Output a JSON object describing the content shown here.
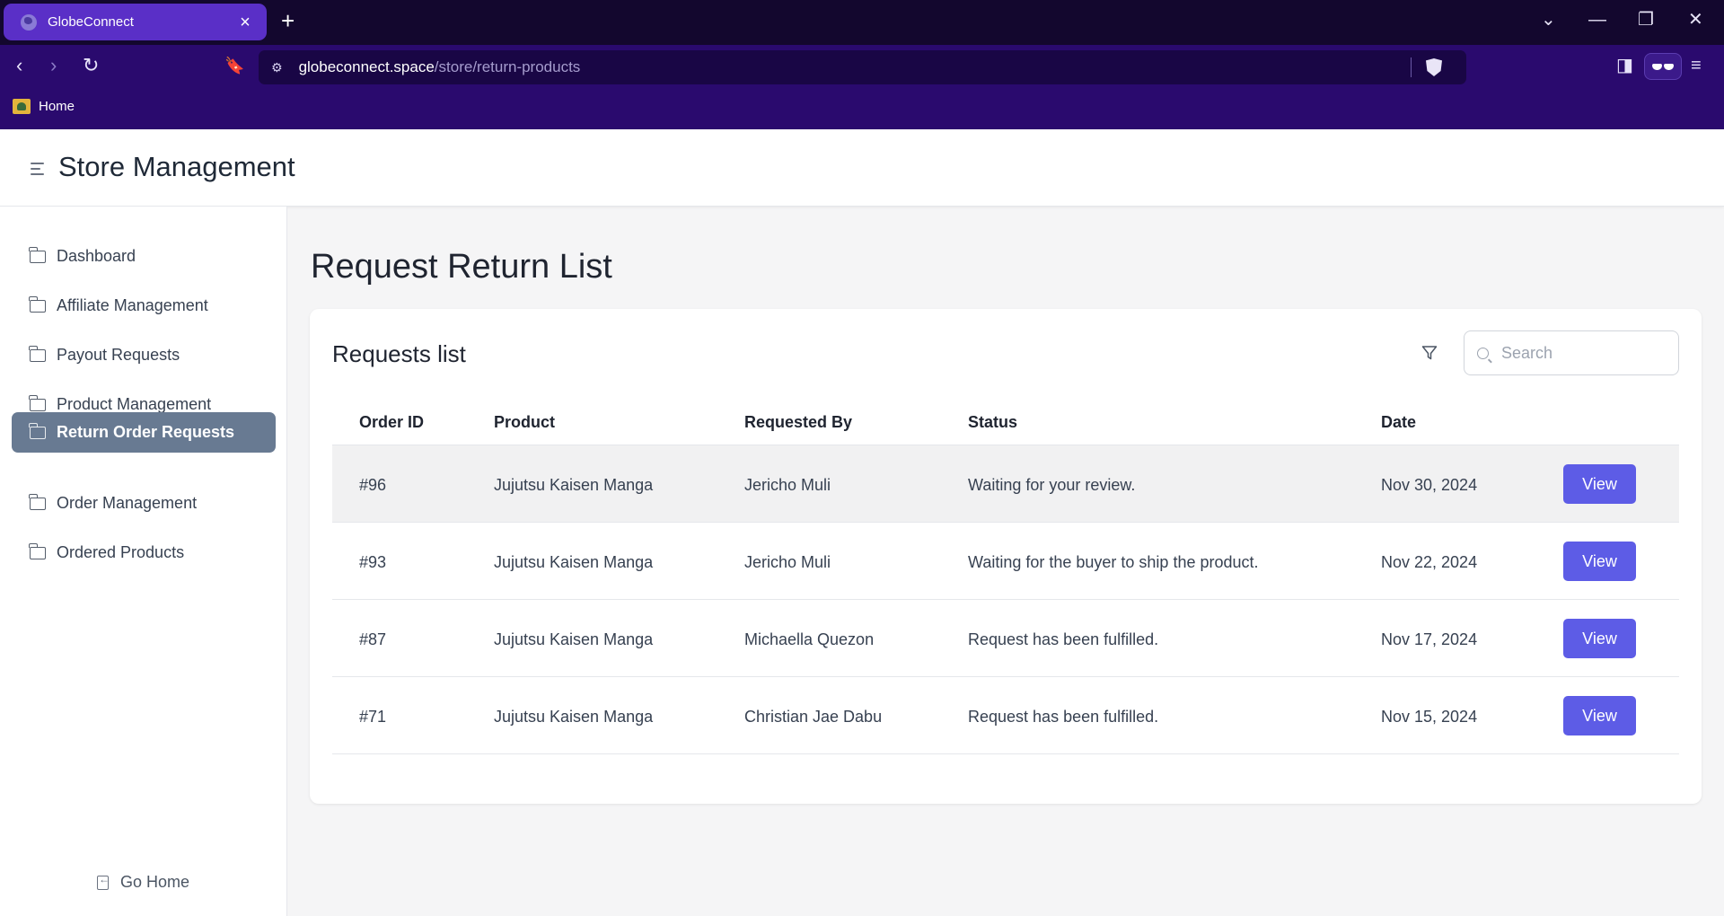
{
  "browser": {
    "tab_title": "GlobeConnect",
    "url_host": "globeconnect.space",
    "url_path": "/store/return-products",
    "bookmark_home": "Home"
  },
  "app": {
    "title": "Store Management"
  },
  "sidebar": {
    "items": [
      {
        "label": "Dashboard",
        "active": false
      },
      {
        "label": "Affiliate Management",
        "active": false
      },
      {
        "label": "Payout Requests",
        "active": false
      },
      {
        "label": "Product Management",
        "active": false
      },
      {
        "label": "Return Order Requests",
        "active": true
      },
      {
        "label": "Order Management",
        "active": false
      },
      {
        "label": "Ordered Products",
        "active": false
      }
    ],
    "go_home": "Go Home"
  },
  "main": {
    "page_title": "Request Return List",
    "card_title": "Requests list",
    "search_placeholder": "Search",
    "columns": [
      "Order ID",
      "Product",
      "Requested By",
      "Status",
      "Date"
    ],
    "rows": [
      {
        "order_id": "#96",
        "product": "Jujutsu Kaisen Manga",
        "requested_by": "Jericho Muli",
        "status": "Waiting for your review.",
        "date": "Nov 30, 2024",
        "action": "View"
      },
      {
        "order_id": "#93",
        "product": "Jujutsu Kaisen Manga",
        "requested_by": "Jericho Muli",
        "status": "Waiting for the buyer to ship the product.",
        "date": "Nov 22, 2024",
        "action": "View"
      },
      {
        "order_id": "#87",
        "product": "Jujutsu Kaisen Manga",
        "requested_by": "Michaella Quezon",
        "status": "Request has been fulfilled.",
        "date": "Nov 17, 2024",
        "action": "View"
      },
      {
        "order_id": "#71",
        "product": "Jujutsu Kaisen Manga",
        "requested_by": "Christian Jae Dabu",
        "status": "Request has been fulfilled.",
        "date": "Nov 15, 2024",
        "action": "View"
      }
    ]
  },
  "colors": {
    "accent": "#5d5ce6",
    "sidebar_active": "#687a92",
    "chrome_tab": "#5a2fc7",
    "chrome_bar": "#2a0a6e"
  }
}
